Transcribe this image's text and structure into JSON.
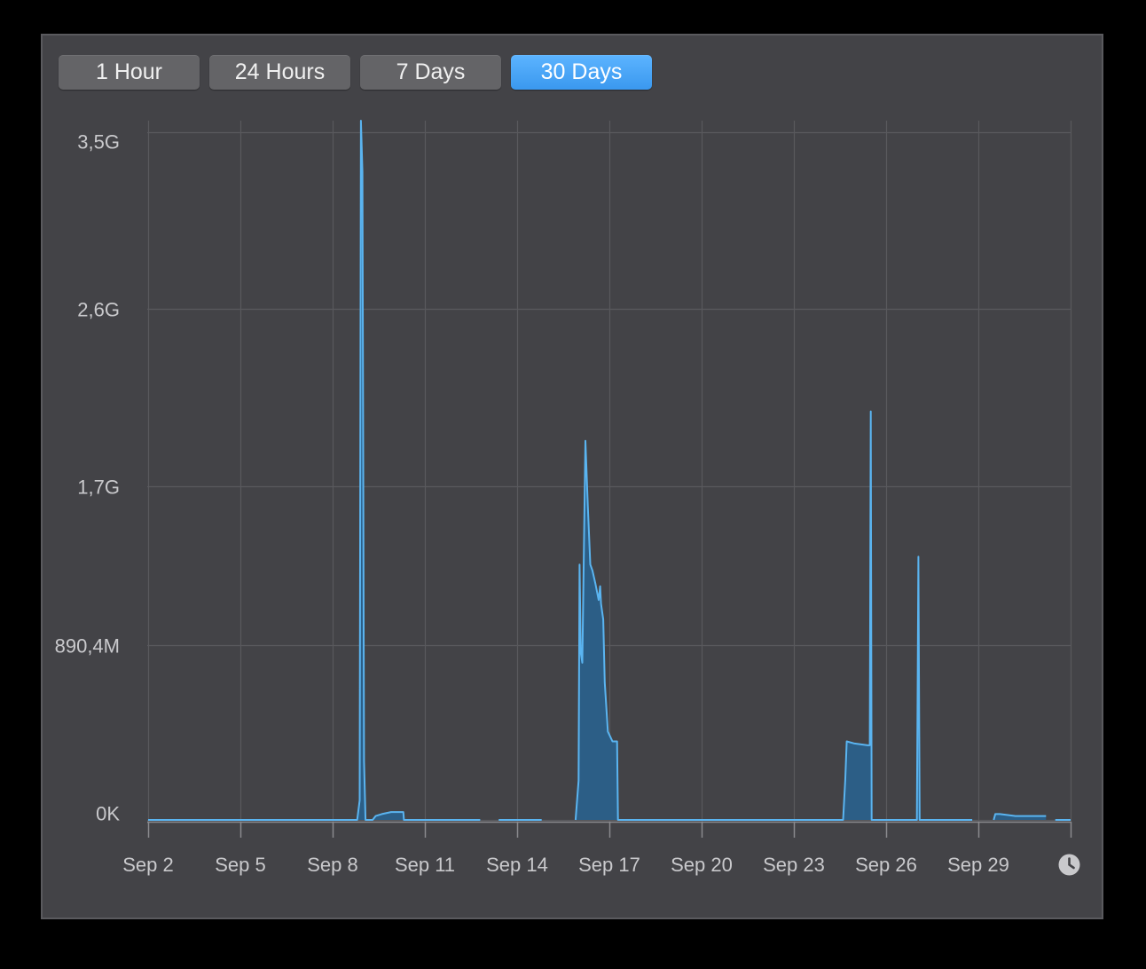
{
  "range_buttons": [
    {
      "label": "1 Hour",
      "active": false
    },
    {
      "label": "24 Hours",
      "active": false
    },
    {
      "label": "7 Days",
      "active": false
    },
    {
      "label": "30 Days",
      "active": true
    }
  ],
  "icons": {
    "time_icon": "clock-icon"
  },
  "colors": {
    "line": "#5ab4f0",
    "fill": "#2c5e86",
    "active_button": "#3e9ef4",
    "grid": "#59595d"
  },
  "chart_data": {
    "type": "area",
    "y_tick_labels": [
      "3,5G",
      "2,6G",
      "1,7G",
      "890,4M",
      "0K"
    ],
    "y_tick_values": [
      3500000000,
      2600000000,
      1700000000,
      890400000,
      0
    ],
    "ylim": [
      0,
      3560000000
    ],
    "x_tick_labels": [
      "Sep 2",
      "Sep 5",
      "Sep 8",
      "Sep 11",
      "Sep 14",
      "Sep 17",
      "Sep 20",
      "Sep 23",
      "Sep 26",
      "Sep 29"
    ],
    "x_tick_days": [
      2,
      5,
      8,
      11,
      14,
      17,
      20,
      23,
      26,
      29
    ],
    "xlim_days": [
      2,
      32
    ],
    "grid": true,
    "series": [
      {
        "segments": [
          [
            [
              2.0,
              0
            ],
            [
              8.8,
              0
            ],
            [
              8.88,
              100000000.0
            ],
            [
              8.92,
              3560000000.0
            ],
            [
              8.97,
              3300000000.0
            ],
            [
              9.02,
              300000000.0
            ],
            [
              9.07,
              0
            ],
            [
              9.3,
              0
            ],
            [
              9.4,
              20000000.0
            ],
            [
              9.6,
              30000000.0
            ],
            [
              9.9,
              40000000.0
            ],
            [
              10.2,
              40000000.0
            ],
            [
              10.3,
              40000000.0
            ],
            [
              10.32,
              0
            ],
            [
              12.8,
              0
            ]
          ],
          [
            [
              13.4,
              0
            ],
            [
              14.8,
              0
            ]
          ],
          [
            [
              15.9,
              0
            ],
            [
              16.0,
              200000000.0
            ],
            [
              16.03,
              1300000000.0
            ],
            [
              16.07,
              850000000.0
            ],
            [
              16.12,
              800000000.0
            ],
            [
              16.22,
              1930000000.0
            ],
            [
              16.3,
              1600000000.0
            ],
            [
              16.38,
              1300000000.0
            ],
            [
              16.45,
              1270000000.0
            ],
            [
              16.55,
              1200000000.0
            ],
            [
              16.65,
              1120000000.0
            ],
            [
              16.7,
              1190000000.0
            ],
            [
              16.73,
              1100000000.0
            ],
            [
              16.8,
              1020000000.0
            ],
            [
              16.85,
              700000000.0
            ],
            [
              16.95,
              450000000.0
            ],
            [
              17.1,
              400000000.0
            ],
            [
              17.25,
              400000000.0
            ],
            [
              17.28,
              0
            ],
            [
              24.6,
              0
            ],
            [
              24.67,
              200000000.0
            ],
            [
              24.72,
              400000000.0
            ],
            [
              24.95,
              390000000.0
            ],
            [
              25.4,
              380000000.0
            ],
            [
              25.47,
              380000000.0
            ],
            [
              25.5,
              2080000000.0
            ],
            [
              25.53,
              0
            ],
            [
              27.0,
              0
            ],
            [
              27.05,
              1340000000.0
            ],
            [
              27.09,
              0
            ],
            [
              28.8,
              0
            ]
          ],
          [
            [
              29.5,
              0
            ],
            [
              29.55,
              30000000.0
            ],
            [
              29.7,
              30000000.0
            ],
            [
              30.2,
              20000000.0
            ],
            [
              31.2,
              20000000.0
            ]
          ],
          [
            [
              31.5,
              0
            ],
            [
              32.0,
              0
            ]
          ]
        ]
      }
    ]
  }
}
